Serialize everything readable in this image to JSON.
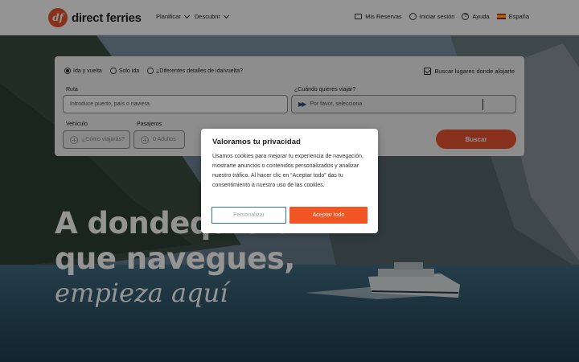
{
  "header": {
    "brand": "direct ferries",
    "brand_mark": "df",
    "nav": [
      {
        "label": "Planificar"
      },
      {
        "label": "Descubrir"
      }
    ],
    "right": {
      "bookings": "Mis Reservas",
      "login": "Iniciar sesión",
      "help": "Ayuda",
      "country": "España"
    }
  },
  "search": {
    "trip_types": [
      {
        "label": "Ida y vuelta",
        "selected": true
      },
      {
        "label": "Solo ida",
        "selected": false
      },
      {
        "label": "¿Diferentes detalles de ida/vuelta?",
        "selected": false
      }
    ],
    "accommodation_label": "Buscar lugares donde alojarte",
    "accommodation_checked": true,
    "route_label": "Ruta",
    "route_placeholder": "Introduce puerto, país o naviera.",
    "date_label": "¿Cuándo quieres viajar?",
    "date_placeholder": "Por favor, selecciona",
    "vehicle_label": "Vehículo",
    "vehicle_placeholder": "¿Cómo viajarás?",
    "passengers_label": "Pasajeros",
    "passengers_value": "0 Adultos",
    "submit_label": "Buscar"
  },
  "hero": {
    "line1": "A dondequiera",
    "line2": "que navegues,",
    "line3": "empieza aquí"
  },
  "cookie_modal": {
    "title": "Valoramos tu privacidad",
    "body": "Usamos cookies para mejorar tu experiencia de navegación, mostrarte anuncios o contenidos personalizados y analizar nuestro tráfico. Al hacer clic en “Aceptar todo” das tu consentimiento a nuestro uso de las cookies.",
    "customize_label": "Personalizar",
    "accept_label": "Aceptar todo"
  },
  "colors": {
    "brand": "#e8542f",
    "accept": "#f05523",
    "customize_border": "#2d6cdf"
  }
}
